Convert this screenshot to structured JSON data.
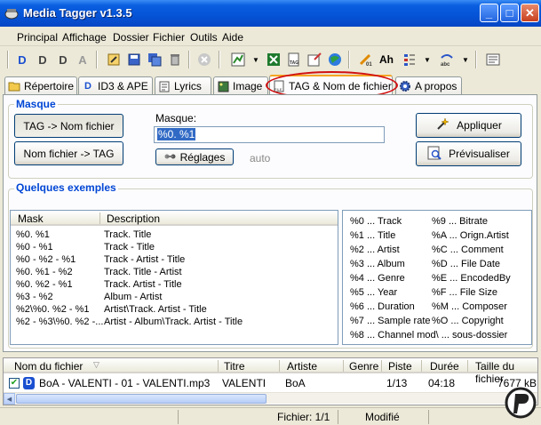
{
  "window": {
    "title": "Media Tagger v1.3.5"
  },
  "menu": [
    "Principal",
    "Affichage",
    "Dossier",
    "Fichier",
    "Outils",
    "Aide"
  ],
  "tabs": [
    "Répertoire",
    "ID3 & APE",
    "Lyrics",
    "Image",
    "TAG & Nom de fichier",
    "A propos"
  ],
  "masque": {
    "group_title": "Masque",
    "btn_tag_to_file": "TAG -> Nom fichier",
    "btn_file_to_tag": "Nom fichier -> TAG",
    "mask_label": "Masque:",
    "mask_value": "%0. %1",
    "btn_settings": "Réglages",
    "auto_label": "auto",
    "btn_apply": "Appliquer",
    "btn_preview": "Prévisualiser"
  },
  "examples": {
    "group_title": "Quelques exemples",
    "headers": [
      "Mask",
      "Description"
    ],
    "rows": [
      [
        "%0. %1",
        "Track. Title"
      ],
      [
        "%0 - %1",
        "Track - Title"
      ],
      [
        "%0 - %2 - %1",
        "Track - Artist - Title"
      ],
      [
        "%0. %1 - %2",
        "Track. Title - Artist"
      ],
      [
        "%0. %2 - %1",
        "Track. Artist - Title"
      ],
      [
        "%3 - %2",
        "Album - Artist"
      ],
      [
        "%2\\%0. %2 - %1",
        "Artist\\Track. Artist - Title"
      ],
      [
        "%2 - %3\\%0. %2 -...",
        "Artist - Album\\Track. Artist - Title"
      ]
    ]
  },
  "codes": [
    [
      "%0 ... Track",
      "%9 ... Bitrate"
    ],
    [
      "%1 ... Title",
      "%A ... Orign.Artist"
    ],
    [
      "%2 ... Artist",
      "%C ... Comment"
    ],
    [
      "%3 ... Album",
      "%D ... File Date"
    ],
    [
      "%4 ... Genre",
      "%E ... EncodedBy"
    ],
    [
      "%5 ... Year",
      "%F ... File Size"
    ],
    [
      "%6 ... Duration",
      "%M ... Composer"
    ],
    [
      "%7 ... Sample rate",
      "%O ... Copyright"
    ],
    [
      "%8 ... Channel mod\\ ... sous-dossier",
      ""
    ]
  ],
  "filelist": {
    "headers": [
      "Nom du fichier",
      "Titre",
      "Artiste",
      "Genre",
      "Piste",
      "Durée",
      "Taille du fichier"
    ],
    "rows": [
      {
        "name": "BoA - VALENTI - 01 - VALENTI.mp3",
        "title": "VALENTI",
        "artist": "BoA",
        "genre": "",
        "track": "1/13",
        "duration": "04:18",
        "size": "7677 kB"
      }
    ]
  },
  "status": {
    "files": "Fichier: 1/1",
    "state": "Modifié"
  },
  "colors": {
    "title_bar": "#0553d6",
    "group_title": "#0046d5",
    "highlight_oval": "#d01010",
    "selection": "#316ac5"
  }
}
